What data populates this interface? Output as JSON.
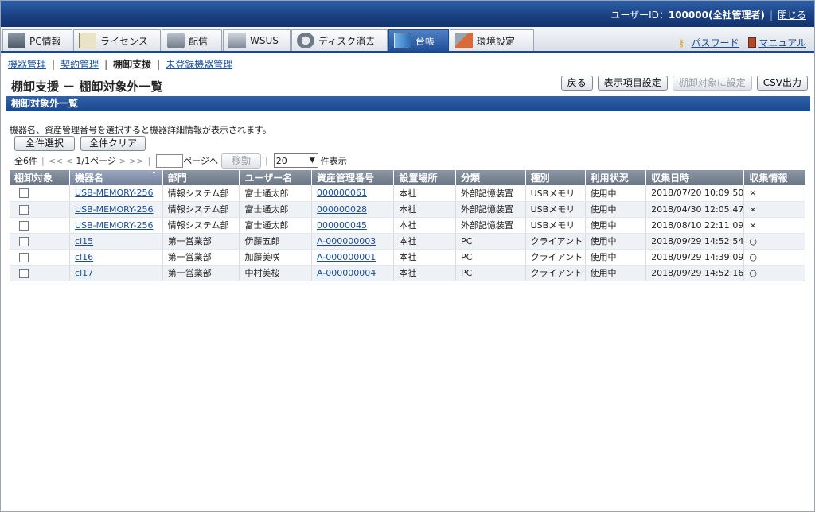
{
  "header": {
    "user_prefix": "ユーザーID：",
    "user_id": "100000(全社管理者)",
    "close_label": "閉じる"
  },
  "tabs": [
    {
      "label": "PC情報",
      "icon": "pc-icon"
    },
    {
      "label": "ライセンス",
      "icon": "license-icon"
    },
    {
      "label": "配信",
      "icon": "distribution-icon"
    },
    {
      "label": "WSUS",
      "icon": "wsus-icon"
    },
    {
      "label": "ディスク消去",
      "icon": "disk-erase-icon"
    },
    {
      "label": "台帳",
      "icon": "ledger-icon",
      "active": true
    },
    {
      "label": "環境設定",
      "icon": "settings-tools-icon"
    }
  ],
  "toplinks": {
    "password": "パスワード",
    "manual": "マニュアル"
  },
  "breadcrumb": {
    "items": [
      "機器管理",
      "契約管理",
      "棚卸支援",
      "未登録機器管理"
    ],
    "current_index": 2
  },
  "page": {
    "title": "棚卸支援 － 棚卸対象外一覧",
    "buttons": {
      "back": "戻る",
      "columns": "表示項目設定",
      "set_target": "棚卸対象に設定",
      "csv": "CSV出力"
    }
  },
  "section": {
    "title": "棚卸対象外一覧",
    "hint": "機器名、資産管理番号を選択すると機器詳細情報が表示されます。",
    "select_all": "全件選択",
    "clear_all": "全件クリア"
  },
  "pager": {
    "total": "全6件",
    "first": "<<",
    "prev": "<",
    "page_info": "1/1ページ",
    "next": ">",
    "last": ">>",
    "goto_suffix": "ページへ",
    "move": "移動",
    "per_page": "20",
    "per_page_suffix": "件表示"
  },
  "table": {
    "columns": [
      "棚卸対象",
      "機器名",
      "部門",
      "ユーザー名",
      "資産管理番号",
      "設置場所",
      "分類",
      "種別",
      "利用状況",
      "収集日時",
      "収集情報"
    ],
    "rows": [
      [
        "",
        "USB-MEMORY-256",
        "情報システム部",
        "富士通太郎",
        "000000061",
        "本社",
        "外部記憶装置",
        "USBメモリ",
        "使用中",
        "2018/07/20 10:09:50",
        "×"
      ],
      [
        "",
        "USB-MEMORY-256",
        "情報システム部",
        "富士通太郎",
        "000000028",
        "本社",
        "外部記憶装置",
        "USBメモリ",
        "使用中",
        "2018/04/30 12:05:47",
        "×"
      ],
      [
        "",
        "USB-MEMORY-256",
        "情報システム部",
        "富士通太郎",
        "000000045",
        "本社",
        "外部記憶装置",
        "USBメモリ",
        "使用中",
        "2018/08/10 22:11:09",
        "×"
      ],
      [
        "",
        "cl15",
        "第一営業部",
        "伊藤五郎",
        "A-000000003",
        "本社",
        "PC",
        "クライアント",
        "使用中",
        "2018/09/29 14:52:54",
        "○"
      ],
      [
        "",
        "cl16",
        "第一営業部",
        "加藤美咲",
        "A-000000001",
        "本社",
        "PC",
        "クライアント",
        "使用中",
        "2018/09/29 14:39:09",
        "○"
      ],
      [
        "",
        "cl17",
        "第一営業部",
        "中村美桜",
        "A-000000004",
        "本社",
        "PC",
        "クライアント",
        "使用中",
        "2018/09/29 14:52:16",
        "○"
      ]
    ]
  }
}
